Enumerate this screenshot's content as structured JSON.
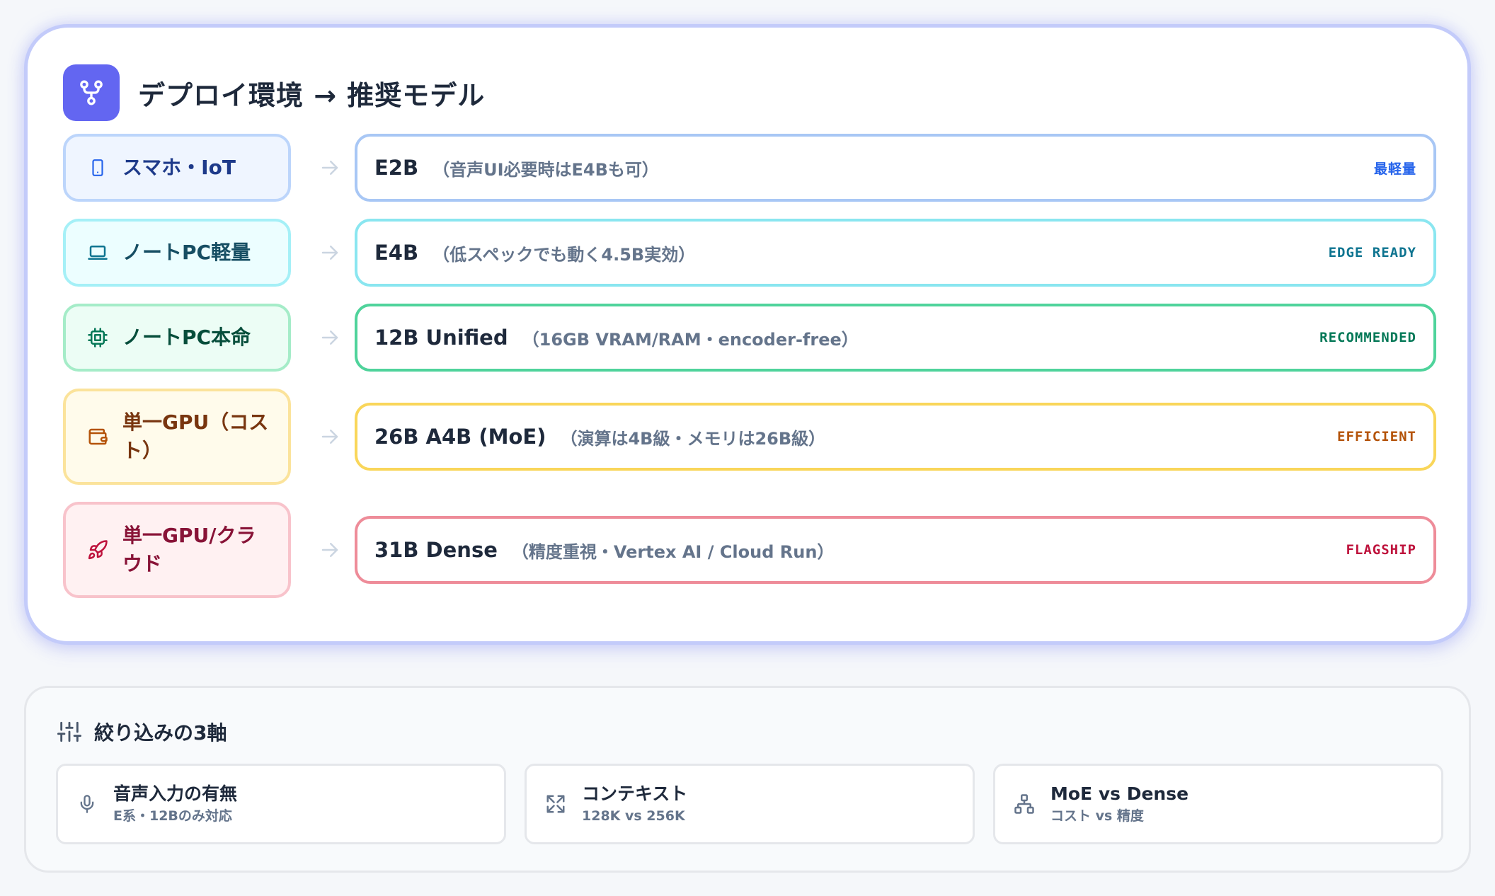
{
  "header": {
    "title": "デプロイ環境 → 推奨モデル",
    "icon": "fork-icon"
  },
  "rows": [
    {
      "env": "スマホ・IoT",
      "env_icon": "smartphone-icon",
      "model": "E2B",
      "note": "（音声UI必要時はE4Bも可）",
      "badge": "最軽量",
      "color": "#2563eb"
    },
    {
      "env": "ノートPC軽量",
      "env_icon": "laptop-icon",
      "model": "E4B",
      "note": "（低スペックでも動く4.5B実効）",
      "badge": "EDGE READY",
      "color": "#0e7490"
    },
    {
      "env": "ノートPC本命",
      "env_icon": "cpu-icon",
      "model": "12B Unified",
      "note": "（16GB VRAM/RAM・encoder-free）",
      "badge": "RECOMMENDED",
      "color": "#047857"
    },
    {
      "env": "単一GPU（コスト）",
      "env_icon": "wallet-icon",
      "model": "26B A4B (MoE)",
      "note": "（演算は4B級・メモリは26B級）",
      "badge": "EFFICIENT",
      "color": "#b45309"
    },
    {
      "env": "単一GPU/クラウド",
      "env_icon": "rocket-icon",
      "model": "31B Dense",
      "note": "（精度重視・Vertex AI / Cloud Run）",
      "badge": "FLAGSHIP",
      "color": "#be123c"
    }
  ],
  "filter": {
    "title": "絞り込みの3軸",
    "icon": "sliders-icon",
    "axes": [
      {
        "title": "音声入力の有無",
        "sub": "E系・12Bのみ対応",
        "icon": "microphone-icon"
      },
      {
        "title": "コンテキスト",
        "sub": "128K vs 256K",
        "icon": "expand-icon"
      },
      {
        "title": "MoE vs Dense",
        "sub": "コスト vs 精度",
        "icon": "network-icon"
      }
    ]
  },
  "colors": {
    "accent": "#6366f1"
  }
}
